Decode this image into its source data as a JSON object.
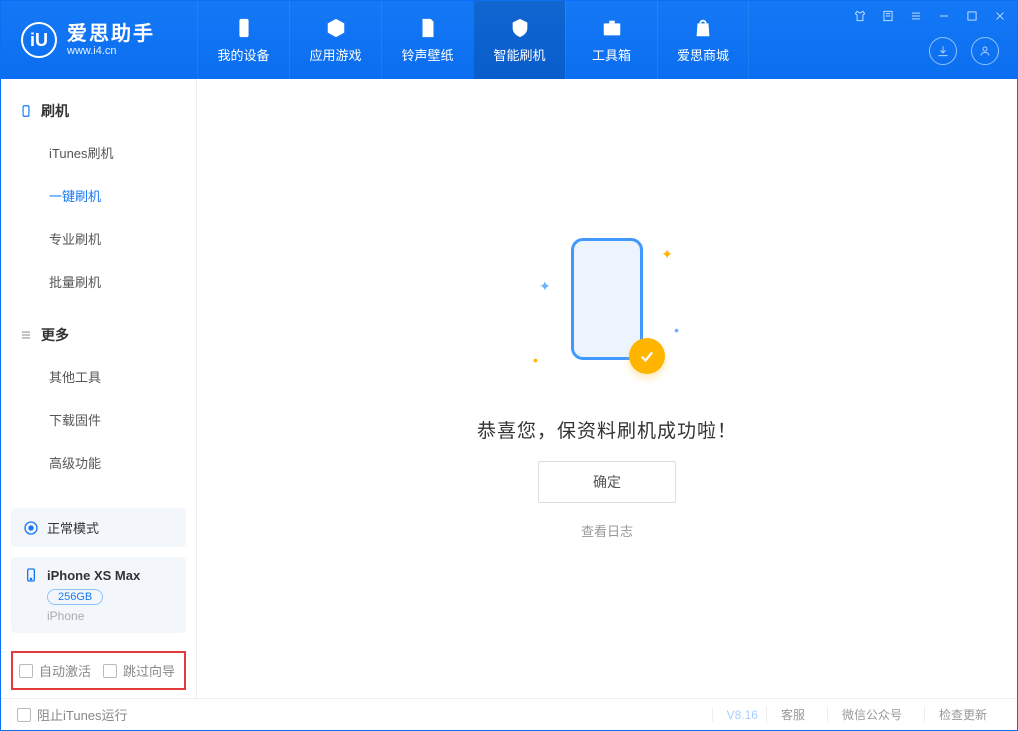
{
  "app": {
    "title": "爱思助手",
    "url": "www.i4.cn"
  },
  "tabs": {
    "device": "我的设备",
    "apps": "应用游戏",
    "ringtone": "铃声壁纸",
    "flash": "智能刷机",
    "toolbox": "工具箱",
    "store": "爱思商城"
  },
  "sidebar": {
    "section1": {
      "title": "刷机",
      "items": {
        "itunes": "iTunes刷机",
        "oneclick": "一键刷机",
        "pro": "专业刷机",
        "batch": "批量刷机"
      }
    },
    "section2": {
      "title": "更多",
      "items": {
        "other": "其他工具",
        "firmware": "下载固件",
        "advanced": "高级功能"
      }
    },
    "mode_card": "正常模式",
    "device_card": {
      "name": "iPhone XS Max",
      "capacity": "256GB",
      "type": "iPhone"
    },
    "bottom": {
      "auto_activate": "自动激活",
      "skip_wizard": "跳过向导"
    }
  },
  "main": {
    "success": "恭喜您，保资料刷机成功啦！",
    "confirm": "确定",
    "view_log": "查看日志"
  },
  "footer": {
    "block_itunes": "阻止iTunes运行",
    "version": "V8.16",
    "support": "客服",
    "wechat": "微信公众号",
    "update": "检查更新"
  }
}
